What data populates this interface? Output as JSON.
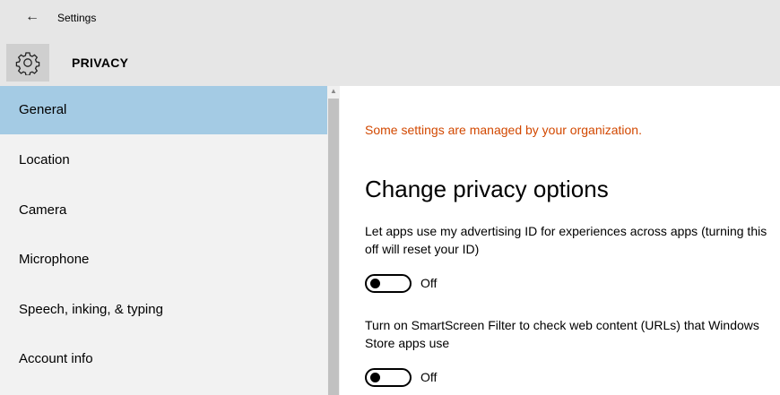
{
  "window": {
    "title": "Settings",
    "back_icon": "back-arrow-icon"
  },
  "header": {
    "icon": "gear-icon",
    "title": "PRIVACY"
  },
  "sidebar": {
    "items": [
      {
        "label": "General",
        "active": true
      },
      {
        "label": "Location",
        "active": false
      },
      {
        "label": "Camera",
        "active": false
      },
      {
        "label": "Microphone",
        "active": false
      },
      {
        "label": "Speech, inking, & typing",
        "active": false
      },
      {
        "label": "Account info",
        "active": false
      }
    ]
  },
  "main": {
    "org_notice": "Some settings are managed by your organization.",
    "section_title": "Change privacy options",
    "settings": [
      {
        "description": "Let apps use my advertising ID for experiences across apps (turning this off will reset your ID)",
        "state": "Off"
      },
      {
        "description": "Turn on SmartScreen Filter to check web content (URLs) that Windows Store apps use",
        "state": "Off"
      }
    ]
  },
  "colors": {
    "accent_selected": "#a4cbe4",
    "notice": "#d24800",
    "chrome": "#e6e6e6"
  }
}
